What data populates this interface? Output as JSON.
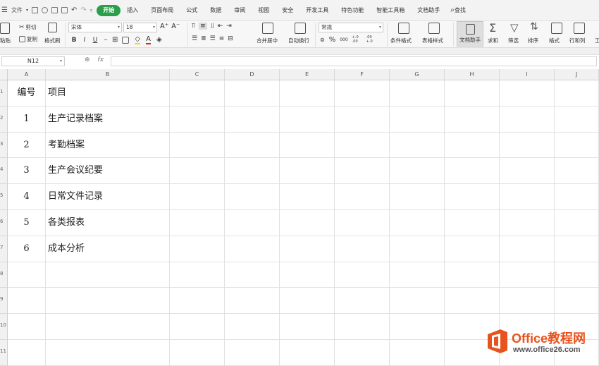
{
  "menubar": {
    "file_label": "文件",
    "tabs": [
      {
        "label": "开始",
        "active": true
      },
      {
        "label": "插入"
      },
      {
        "label": "页面布局"
      },
      {
        "label": "公式"
      },
      {
        "label": "数据"
      },
      {
        "label": "审阅"
      },
      {
        "label": "视图"
      },
      {
        "label": "安全"
      },
      {
        "label": "开发工具"
      },
      {
        "label": "特色功能"
      },
      {
        "label": "智能工具箱"
      },
      {
        "label": "文档助手"
      }
    ],
    "search_label": "查找"
  },
  "ribbon": {
    "paste_label": "粘贴",
    "cut_label": "剪切",
    "copy_label": "复制",
    "format_painter_label": "格式刷",
    "font_name": "宋体",
    "font_size": "18",
    "bold": "B",
    "italic": "I",
    "underline": "U",
    "font_grow": "A⁺",
    "font_shrink": "A⁻",
    "merge_center_label": "合并居中",
    "wrap_text_label": "自动换行",
    "number_format": "常规",
    "percent": "%",
    "thousands": "000",
    "inc_decimal": "+.0 .00",
    "dec_decimal": ".00 +.0",
    "conditional_format_label": "条件格式",
    "table_style_label": "表格样式",
    "doc_helper_label": "文档助手",
    "sum_label": "求和",
    "filter_label": "筛选",
    "sort_label": "排序",
    "format_label": "格式",
    "row_col_label": "行和列",
    "more_label": "工"
  },
  "formula_bar": {
    "name_box": "N12",
    "fx_label": "fx",
    "formula": ""
  },
  "sheet": {
    "columns": [
      "A",
      "B",
      "C",
      "D",
      "E",
      "F",
      "G",
      "H",
      "I",
      "J"
    ],
    "rows": [
      {
        "num": "1",
        "a": "编号",
        "b": "项目"
      },
      {
        "num": "2",
        "a": "1",
        "b": "生产记录档案"
      },
      {
        "num": "3",
        "a": "2",
        "b": "考勤档案"
      },
      {
        "num": "4",
        "a": "3",
        "b": "生产会议纪要"
      },
      {
        "num": "5",
        "a": "4",
        "b": "日常文件记录"
      },
      {
        "num": "6",
        "a": "5",
        "b": "各类报表"
      },
      {
        "num": "7",
        "a": "6",
        "b": "成本分析"
      },
      {
        "num": "8",
        "a": "",
        "b": ""
      },
      {
        "num": "9",
        "a": "",
        "b": ""
      },
      {
        "num": "10",
        "a": "",
        "b": ""
      },
      {
        "num": "11",
        "a": "",
        "b": ""
      }
    ]
  },
  "watermark": {
    "brand": "Office教程网",
    "url": "www.office26.com"
  }
}
